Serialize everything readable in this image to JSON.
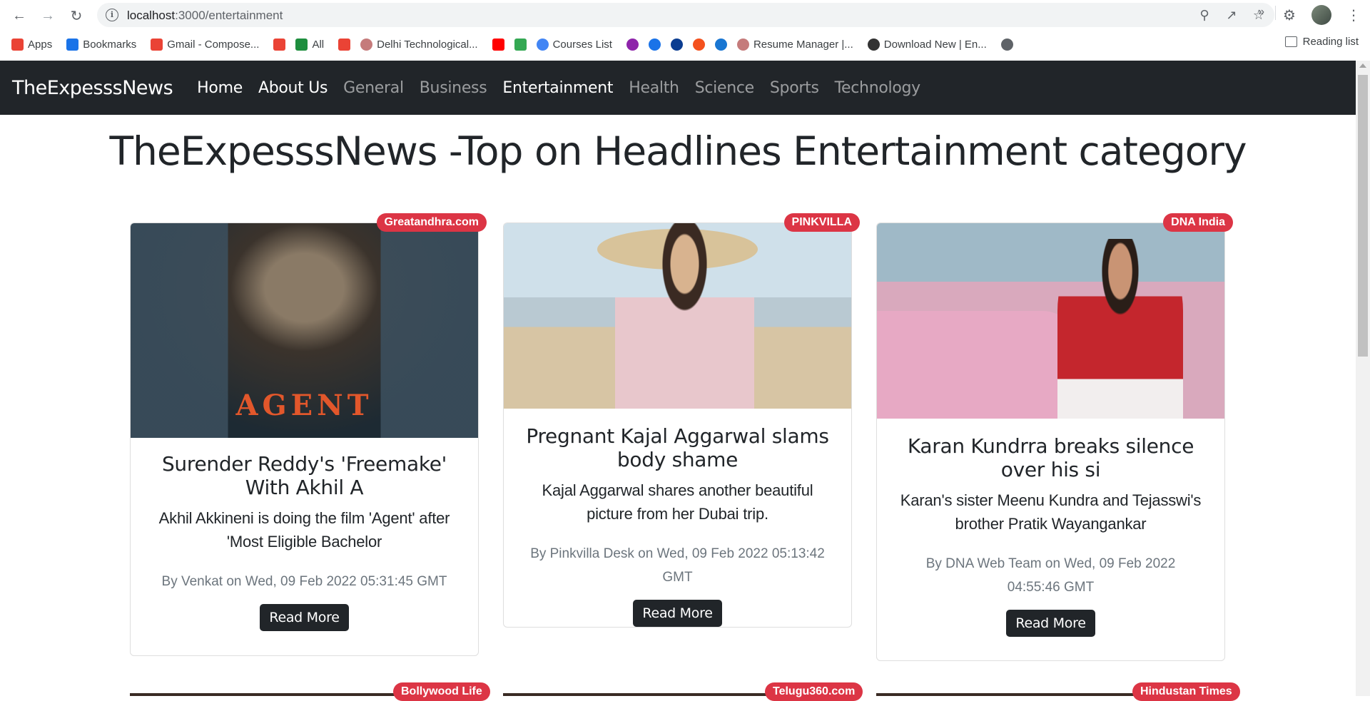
{
  "browser": {
    "url_host": "localhost",
    "url_path": ":3000/entertainment",
    "bookmarks": [
      {
        "label": "Apps",
        "icon": "apps-grid-icon",
        "color": "#ea4335"
      },
      {
        "label": "Bookmarks",
        "icon": "star-icon",
        "color": "#1a73e8"
      },
      {
        "label": "Gmail - Compose...",
        "icon": "gmail-icon",
        "color": "#ea4335"
      },
      {
        "label": "",
        "icon": "gmail-icon",
        "color": "#ea4335"
      },
      {
        "label": "All",
        "icon": "classroom-icon",
        "color": "#1e8e3e"
      },
      {
        "label": "",
        "icon": "gmail-icon",
        "color": "#ea4335"
      },
      {
        "label": "Delhi Technological...",
        "icon": "dtu-icon",
        "color": "#c57b7b"
      },
      {
        "label": "",
        "icon": "youtube-icon",
        "color": "#ff0000"
      },
      {
        "label": "",
        "icon": "maps-icon",
        "color": "#34a853"
      },
      {
        "label": "Courses List",
        "icon": "google-icon",
        "color": "#4285f4"
      },
      {
        "label": "",
        "icon": "circle-icon",
        "color": "#8e24aa"
      },
      {
        "label": "",
        "icon": "circle-icon",
        "color": "#1a73e8"
      },
      {
        "label": "",
        "icon": "site-icon",
        "color": "#0b3d91"
      },
      {
        "label": "",
        "icon": "site-icon",
        "color": "#f4511e"
      },
      {
        "label": "",
        "icon": "play-icon",
        "color": "#1976d2"
      },
      {
        "label": "Resume Manager |...",
        "icon": "dtu-icon",
        "color": "#c57b7b"
      },
      {
        "label": "Download New | En...",
        "icon": "site-icon",
        "color": "#333333"
      },
      {
        "label": "",
        "icon": "globe-icon",
        "color": "#5f6368"
      }
    ],
    "more": "»",
    "reading_list": "Reading list"
  },
  "site": {
    "brand": "TheExpesssNews",
    "nav": [
      {
        "label": "Home",
        "active": true
      },
      {
        "label": "About Us",
        "active": true
      },
      {
        "label": "General",
        "active": false
      },
      {
        "label": "Business",
        "active": false
      },
      {
        "label": "Entertainment",
        "active": true
      },
      {
        "label": "Health",
        "active": false
      },
      {
        "label": "Science",
        "active": false
      },
      {
        "label": "Sports",
        "active": false
      },
      {
        "label": "Technology",
        "active": false
      }
    ],
    "heading": "TheExpesssNews -Top on Headlines Entertainment category"
  },
  "cards": [
    {
      "source": "Greatandhra.com",
      "title": "Surender Reddy's 'Freemake' With Akhil A",
      "description": "Akhil Akkineni is doing the film 'Agent' after 'Most Eligible Bachelor",
      "meta": "By Venkat on Wed, 09 Feb 2022 05:31:45 GMT",
      "button": "Read More",
      "image_text": "AGENT"
    },
    {
      "source": "PINKVILLA",
      "title": "Pregnant Kajal Aggarwal slams body shame",
      "description": "Kajal Aggarwal shares another beautiful picture from her Dubai trip.",
      "meta": "By Pinkvilla Desk on Wed, 09 Feb 2022 05:13:42 GMT",
      "button": "Read More"
    },
    {
      "source": "DNA India",
      "title": "Karan Kundrra breaks silence over his si",
      "description": "Karan's sister Meenu Kundra and Tejasswi's brother Pratik Wayangankar",
      "meta": "By DNA Web Team on Wed, 09 Feb 2022 04:55:46 GMT",
      "button": "Read More"
    }
  ],
  "next_row_sources": [
    "Bollywood Life",
    "Telugu360.com",
    "Hindustan Times"
  ],
  "colors": {
    "navbar": "#212529",
    "badge": "#dc3545",
    "button": "#212529",
    "meta_text": "#6c757d"
  }
}
